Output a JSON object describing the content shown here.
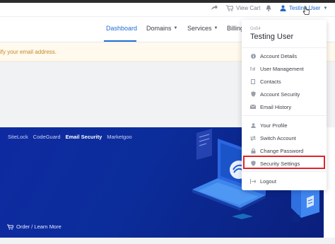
{
  "topbar": {
    "view_cart_label": "View Cart",
    "user_label": "Testing User"
  },
  "nav": {
    "items": [
      {
        "label": "Dashboard"
      },
      {
        "label": "Domains"
      },
      {
        "label": "Services"
      },
      {
        "label": "Billing"
      }
    ]
  },
  "alert": {
    "text": "ify your email address."
  },
  "banner": {
    "tabs": [
      "SiteLock",
      "CodeGuard",
      "Email Security",
      "Marketgoo"
    ],
    "active_tab": "Email Security",
    "order_label": "Order / Learn More"
  },
  "dropdown": {
    "company": "Go54",
    "user_name": "Testing User",
    "section1": [
      {
        "label": "Account Details",
        "icon": "info-icon"
      },
      {
        "label": "User Management",
        "icon": "users-icon"
      },
      {
        "label": "Contacts",
        "icon": "contact-book-icon"
      },
      {
        "label": "Account Security",
        "icon": "shield-icon"
      },
      {
        "label": "Email History",
        "icon": "envelope-icon"
      }
    ],
    "section2": [
      {
        "label": "Your Profile",
        "icon": "user-icon"
      },
      {
        "label": "Switch Account",
        "icon": "switch-icon"
      },
      {
        "label": "Change Password",
        "icon": "key-icon"
      },
      {
        "label": "Security Settings",
        "icon": "shield-icon"
      }
    ],
    "logout_label": "Logout",
    "highlight_color": "#e0242c"
  },
  "colors": {
    "accent": "#1f6fd1",
    "alert_text": "#c58a25",
    "banner_bg": "#0b2d9c"
  }
}
